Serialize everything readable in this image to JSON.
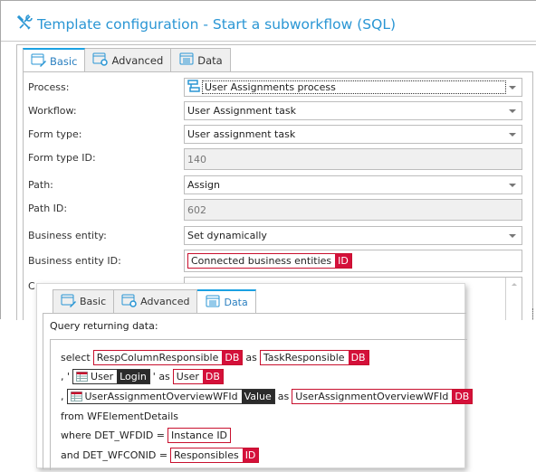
{
  "window": {
    "title": "Template configuration - Start a subworkflow (SQL)",
    "title_icon": "tools-icon",
    "accent_color": "#2a96d4"
  },
  "back_tabs": [
    {
      "label": "Basic",
      "icon": "form-edit-icon",
      "active": true
    },
    {
      "label": "Advanced",
      "icon": "form-settings-icon",
      "active": false
    },
    {
      "label": "Data",
      "icon": "data-list-icon",
      "active": false
    }
  ],
  "form": {
    "process": {
      "label": "Process:",
      "value": "User Assignments process",
      "icon": "process-icon"
    },
    "workflow": {
      "label": "Workflow:",
      "value": "User Assignment task"
    },
    "form_type": {
      "label": "Form type:",
      "value": "User assignment task"
    },
    "form_type_id": {
      "label": "Form type ID:",
      "value": "140"
    },
    "path": {
      "label": "Path:",
      "value": "Assign"
    },
    "path_id": {
      "label": "Path ID:",
      "value": "602"
    },
    "business_entity": {
      "label": "Business entity:",
      "value": "Set dynamically"
    },
    "business_entity_id": {
      "label": "Business entity ID:",
      "tag_text": "Connected business entities",
      "tag_badge": "ID"
    },
    "truncated_label": "C"
  },
  "popup": {
    "tabs": [
      {
        "label": "Basic",
        "icon": "form-edit-icon",
        "active": false
      },
      {
        "label": "Advanced",
        "icon": "form-settings-icon",
        "active": false
      },
      {
        "label": "Data",
        "icon": "data-list-icon",
        "active": true
      }
    ],
    "query_label": "Query returning data:",
    "query": {
      "line1": {
        "kw1": "select",
        "tag1_text": "RespColumnResponsible",
        "tag1_badge": "DB",
        "kw2": "as",
        "tag2_text": "TaskResponsible",
        "tag2_badge": "DB"
      },
      "line2": {
        "prefix": ", '",
        "tag1_text": "User",
        "tag1_badge": "Login",
        "mid": "' as",
        "tag2_text": "User",
        "tag2_badge": "DB"
      },
      "line3": {
        "prefix": ",",
        "tag1_text": "UserAssignmentOverviewWFId",
        "tag1_badge": "Value",
        "kw": "as",
        "tag2_text": "UserAssignmentOverviewWFId",
        "tag2_badge": "DB"
      },
      "line4": {
        "text": "from WFElementDetails"
      },
      "line5": {
        "kw": "where DET_WFDID =",
        "tag_text": "Instance ID"
      },
      "line6": {
        "kw": "and DET_WFCONID =",
        "tag_text": "Responsibles",
        "tag_badge": "ID"
      }
    },
    "colors": {
      "db_badge": "#d4103a",
      "dark_badge": "#2b2b2b"
    }
  }
}
